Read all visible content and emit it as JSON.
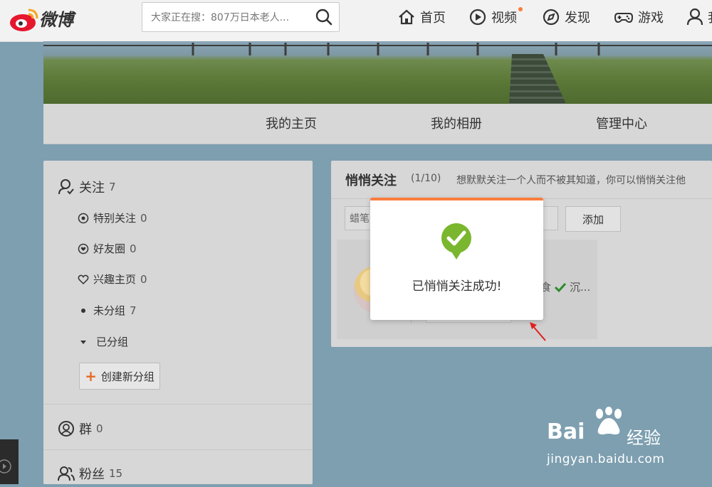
{
  "header": {
    "logo_text": "微博",
    "search": {
      "value": "大家正在搜：807万日本老人...",
      "placeholder": "大家正在搜：807万日本老人..."
    },
    "nav": [
      {
        "label": "首页",
        "icon": "home-icon"
      },
      {
        "label": "视频",
        "icon": "video-icon",
        "has_dot": true
      },
      {
        "label": "发现",
        "icon": "compass-icon"
      },
      {
        "label": "游戏",
        "icon": "gamepad-icon"
      },
      {
        "label": "我",
        "icon": "user-icon"
      }
    ]
  },
  "profile_tabs": [
    "我的主页",
    "我的相册",
    "管理中心"
  ],
  "left_panel": {
    "follow": {
      "label": "关注",
      "count": "7"
    },
    "groups": [
      {
        "label": "特别关注",
        "count": "0",
        "icon": "star-circle-icon"
      },
      {
        "label": "好友圈",
        "count": "0",
        "icon": "heart-circle-icon"
      },
      {
        "label": "兴趣主页",
        "count": "0",
        "icon": "heart-outline-icon"
      },
      {
        "label": "未分组",
        "count": "7",
        "icon": "dot-icon"
      },
      {
        "label": "已分组",
        "count": "",
        "icon": "triangle-down-icon"
      }
    ],
    "create_group": "创建新分组",
    "group_chat": {
      "label": "群",
      "count": "0"
    },
    "fans": {
      "label": "粉丝",
      "count": "15"
    }
  },
  "right_panel": {
    "title": "悄悄关注",
    "count": "(1/10)",
    "description": "想默默关注一个人而不被其知道，你可以悄悄关注他",
    "input_value": "蜡笔",
    "add_button": "添加",
    "card_name_fragment": "食",
    "card_name_suffix": "沉..."
  },
  "modal": {
    "message": "已悄悄关注成功!"
  },
  "watermark": {
    "brand": "Bai",
    "jingyan": "经验",
    "url": "jingyan.baidu.com"
  },
  "colors": {
    "accent": "#fa7d3c",
    "success": "#7ab72e",
    "overlay_bg": "#7d9fb0"
  }
}
